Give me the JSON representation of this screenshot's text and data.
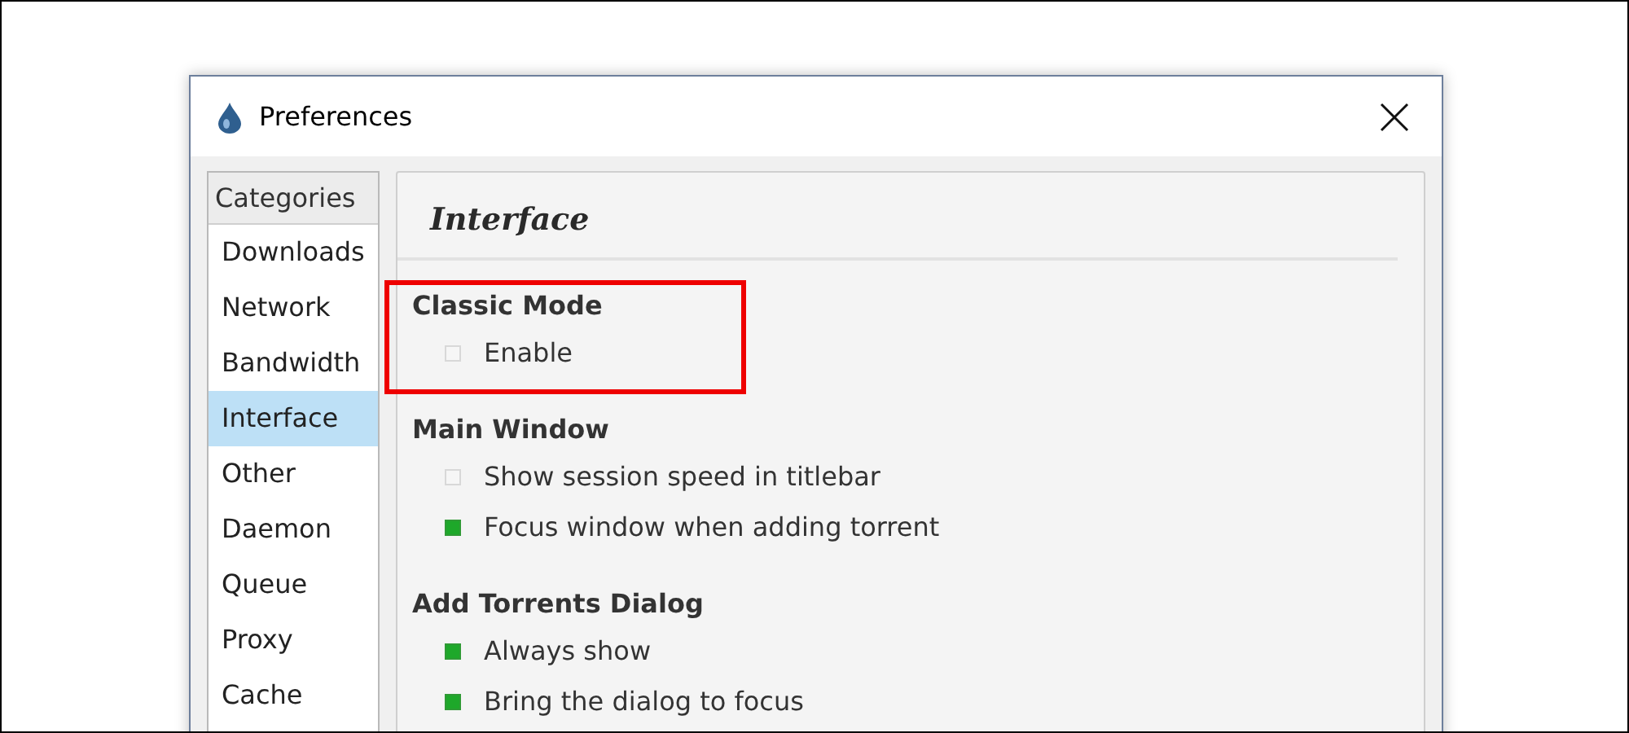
{
  "window": {
    "title": "Preferences"
  },
  "categories": {
    "header": "Categories",
    "items": [
      {
        "label": "Downloads",
        "selected": false
      },
      {
        "label": "Network",
        "selected": false
      },
      {
        "label": "Bandwidth",
        "selected": false
      },
      {
        "label": "Interface",
        "selected": true
      },
      {
        "label": "Other",
        "selected": false
      },
      {
        "label": "Daemon",
        "selected": false
      },
      {
        "label": "Queue",
        "selected": false
      },
      {
        "label": "Proxy",
        "selected": false
      },
      {
        "label": "Cache",
        "selected": false
      }
    ]
  },
  "page": {
    "title": "Interface",
    "sections": [
      {
        "title": "Classic Mode",
        "highlighted": true,
        "options": [
          {
            "label": "Enable",
            "checked": false
          }
        ]
      },
      {
        "title": "Main Window",
        "highlighted": false,
        "options": [
          {
            "label": "Show session speed in titlebar",
            "checked": false
          },
          {
            "label": "Focus window when adding torrent",
            "checked": true
          }
        ]
      },
      {
        "title": "Add Torrents Dialog",
        "highlighted": false,
        "options": [
          {
            "label": "Always show",
            "checked": true
          },
          {
            "label": "Bring the dialog to focus",
            "checked": true
          }
        ]
      }
    ]
  }
}
